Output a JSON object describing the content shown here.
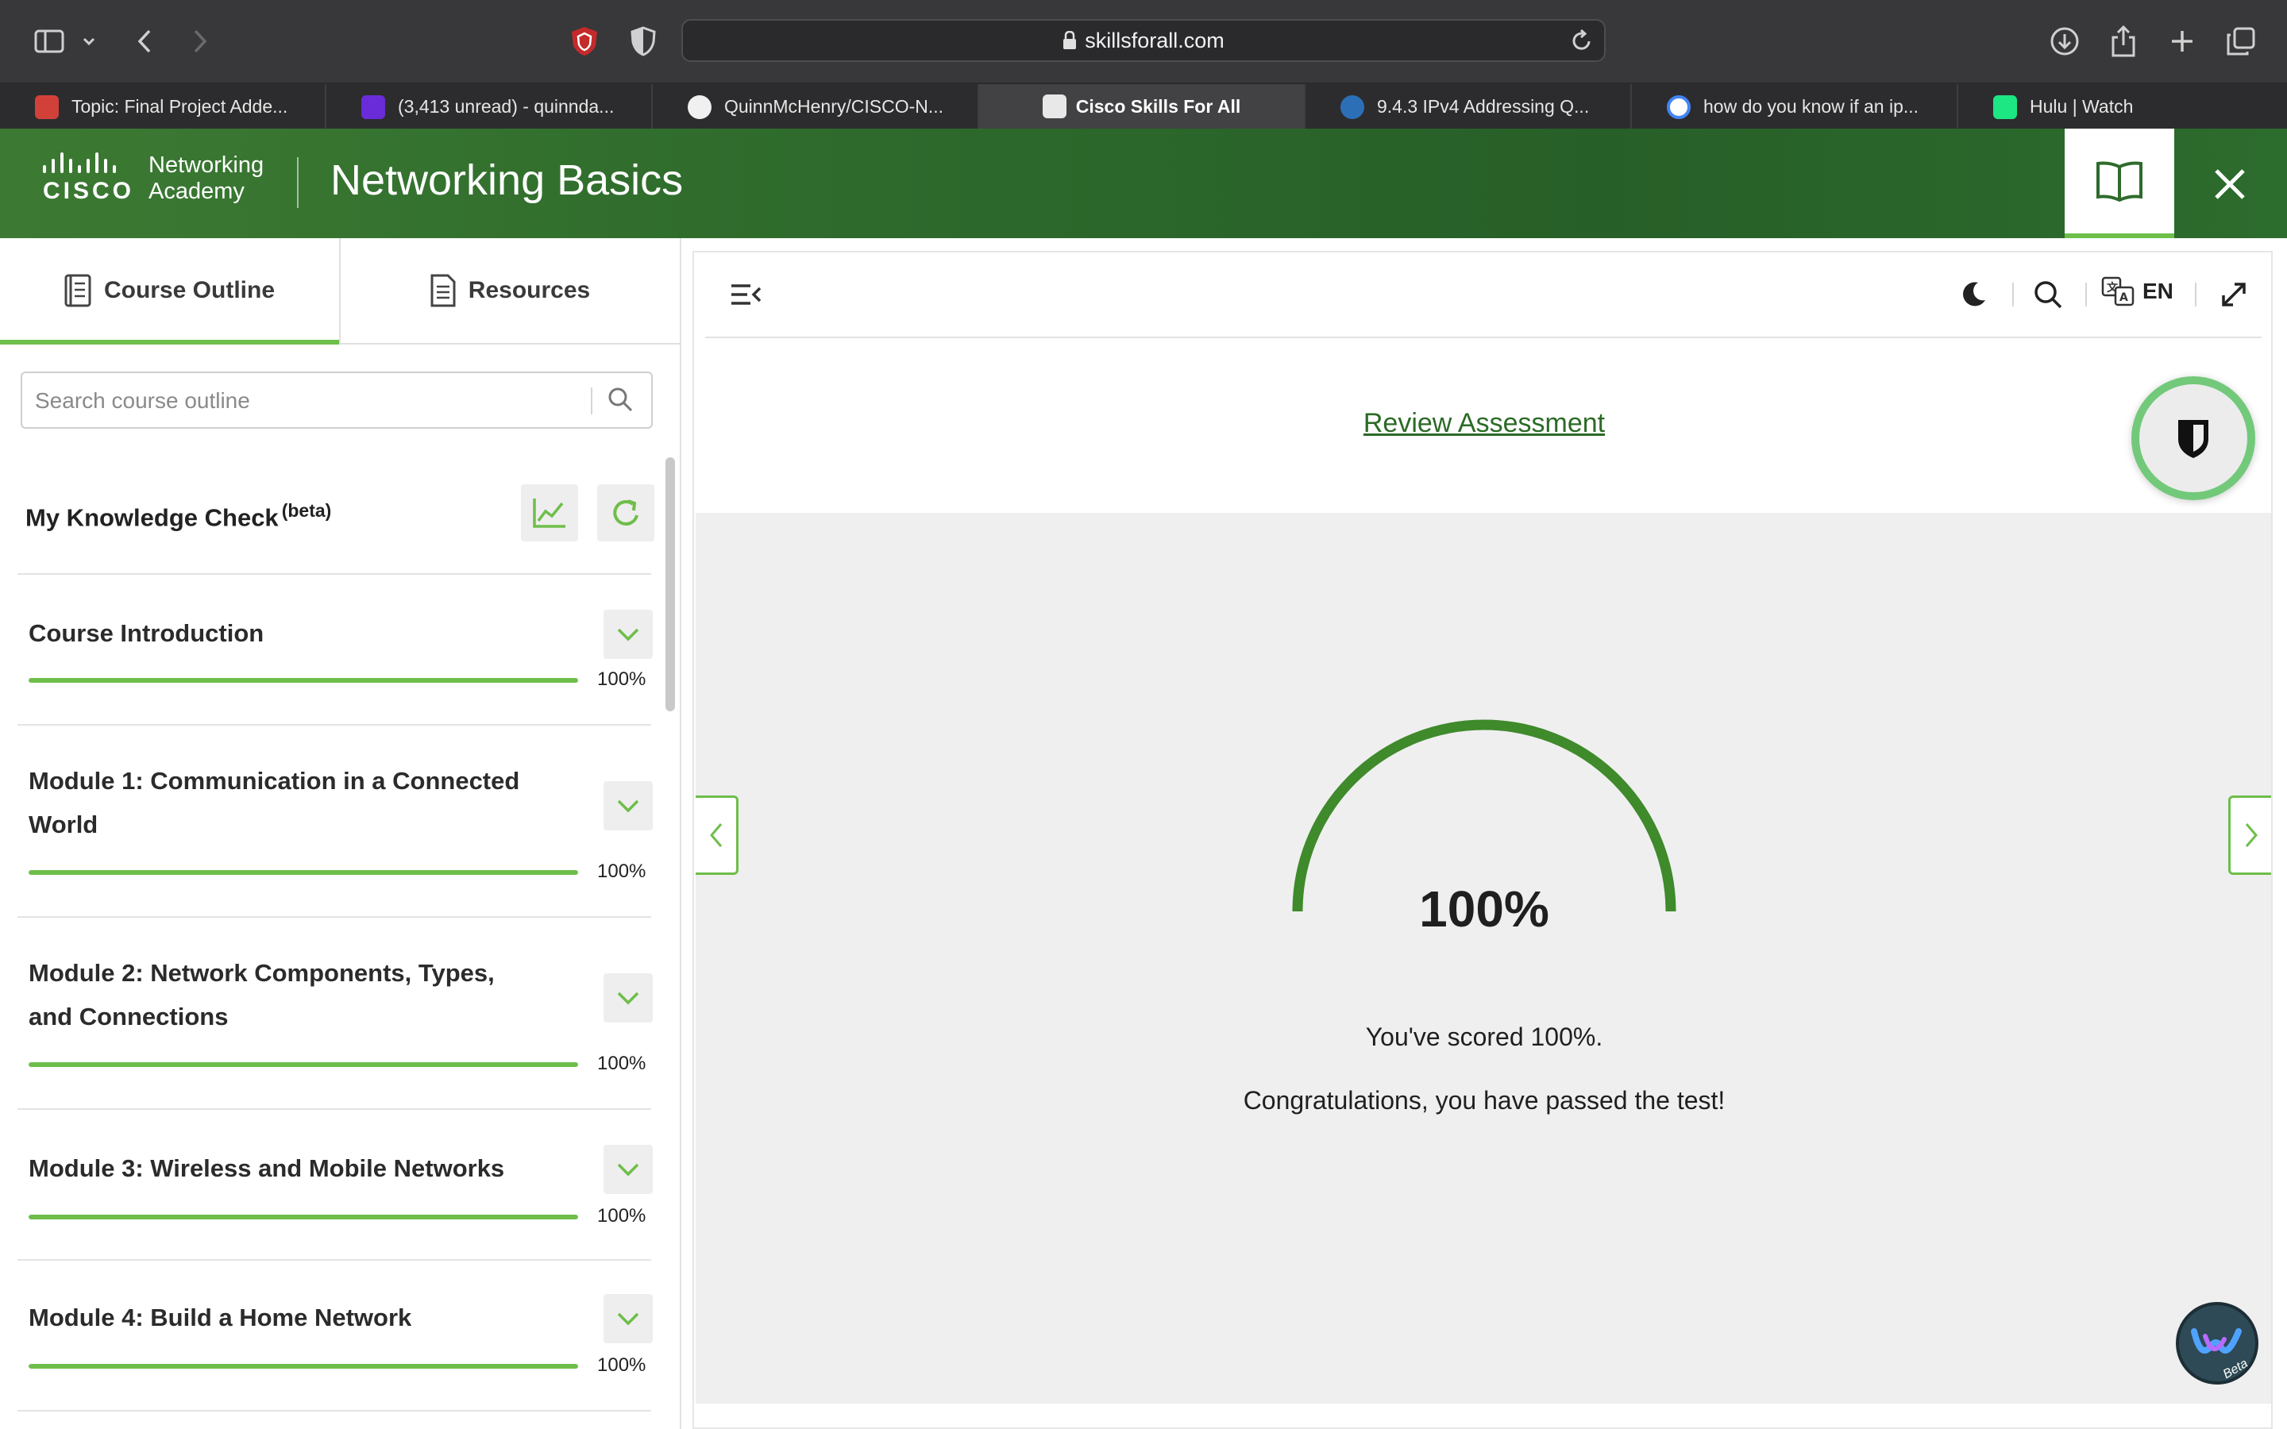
{
  "browser": {
    "url": "skillsforall.com",
    "tabs": [
      {
        "label": "Topic: Final Project Adde...",
        "icon": "canvas-icon",
        "active": false
      },
      {
        "label": "(3,413 unread) - quinnda...",
        "icon": "yahoo-mail-icon",
        "active": false
      },
      {
        "label": "QuinnMcHenry/CISCO-N...",
        "icon": "github-icon",
        "active": false
      },
      {
        "label": "Cisco Skills For All",
        "icon": "cisco-icon",
        "active": true
      },
      {
        "label": "9.4.3 IPv4 Addressing Q...",
        "icon": "itexamanswers-icon",
        "active": false
      },
      {
        "label": "how do you know if an ip...",
        "icon": "google-icon",
        "active": false
      },
      {
        "label": "Hulu | Watch",
        "icon": "hulu-icon",
        "active": false
      }
    ]
  },
  "header": {
    "logo_line1": "Networking",
    "logo_line2": "Academy",
    "logo_word": "CISCO",
    "title": "Networking Basics"
  },
  "sidebar": {
    "tabs": [
      {
        "label": "Course Outline",
        "active": true
      },
      {
        "label": "Resources",
        "active": false
      }
    ],
    "search_placeholder": "Search course outline",
    "knowledge_check": {
      "title": "My Knowledge Check",
      "badge": "(beta)"
    },
    "modules": [
      {
        "title": "Course Introduction",
        "progress": "100%"
      },
      {
        "title": "Module 1: Communication in a Connected World",
        "progress": "100%"
      },
      {
        "title": "Module 2: Network Components, Types, and Connections",
        "progress": "100%"
      },
      {
        "title": "Module 3: Wireless and Mobile Networks",
        "progress": "100%"
      },
      {
        "title": "Module 4: Build a Home Network",
        "progress": "100%"
      }
    ]
  },
  "content": {
    "language": "EN",
    "review_link": "Review Assessment",
    "score": "100%",
    "score_fraction": 1.0,
    "message_score": "You've scored 100%.",
    "message_pass": "Congratulations, you have passed the test!"
  },
  "colors": {
    "accent_green": "#6ebe4a",
    "gauge_green": "#3f8a2b",
    "header_green": "#2e6b2c"
  }
}
